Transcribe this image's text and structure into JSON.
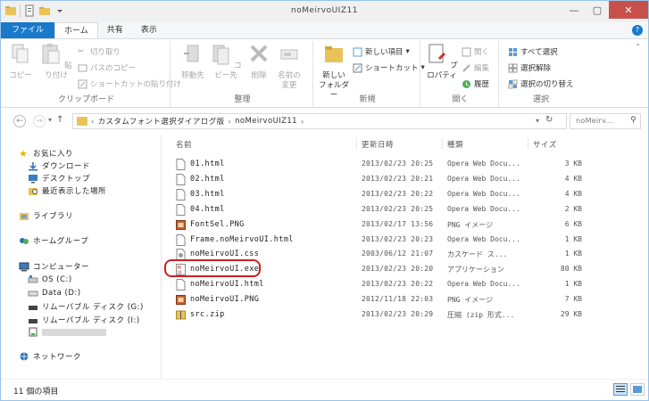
{
  "window": {
    "title": "noMeirvoUIZ11"
  },
  "ribbon_tabs": [
    {
      "label": "ファイル"
    },
    {
      "label": "ホーム"
    },
    {
      "label": "共有"
    },
    {
      "label": "表示"
    }
  ],
  "ribbon": {
    "clipboard": {
      "label": "クリップボード",
      "copy": "コピー",
      "paste": "貼り付け",
      "cut": "切り取り",
      "copy_path": "パスのコピー",
      "paste_shortcut": "ショートカットの貼り付け"
    },
    "organize": {
      "label": "整理",
      "move_to": "移動先",
      "copy_to": "コピー先",
      "delete": "削除",
      "rename_line1": "名前の",
      "rename_line2": "変更"
    },
    "new": {
      "label": "新規",
      "new_folder_line1": "新しい",
      "new_folder_line2": "フォルダー",
      "new_item": "新しい項目",
      "shortcut": "ショートカット"
    },
    "open": {
      "label": "開く",
      "properties": "プロパティ",
      "open": "開く",
      "edit": "編集",
      "history": "履歴"
    },
    "select": {
      "label": "選択",
      "select_all": "すべて選択",
      "select_none": "選択解除",
      "invert": "選択の切り替え"
    }
  },
  "address": {
    "path": [
      "カスタムフォント選択ダイアログ版",
      "noMeirvoUIZ11"
    ],
    "search_placeholder": "noMeirv...",
    "search_icon": "search-icon"
  },
  "nav_pane": {
    "favorites": "お気に入り",
    "downloads": "ダウンロード",
    "desktop": "デスクトップ",
    "recent": "最近表示した場所",
    "libraries": "ライブラリ",
    "homegroup": "ホームグループ",
    "computer": "コンピューター",
    "drive_os": "OS (C:)",
    "drive_data": "Data (D:)",
    "removable_g": "リムーバブル ディスク (G:)",
    "removable_i": "リムーバブル ディスク (I:)",
    "network": "ネットワーク"
  },
  "columns": {
    "name": "名前",
    "date": "更新日時",
    "type": "種類",
    "size": "サイズ"
  },
  "files": [
    {
      "name": "01.html",
      "date": "2013/02/23 20:25",
      "type": "Opera Web Docu...",
      "size": "3 KB",
      "icon": "html-file-icon"
    },
    {
      "name": "02.html",
      "date": "2013/02/23 20:21",
      "type": "Opera Web Docu...",
      "size": "4 KB",
      "icon": "html-file-icon"
    },
    {
      "name": "03.html",
      "date": "2013/02/23 20:22",
      "type": "Opera Web Docu...",
      "size": "4 KB",
      "icon": "html-file-icon"
    },
    {
      "name": "04.html",
      "date": "2013/02/23 20:25",
      "type": "Opera Web Docu...",
      "size": "2 KB",
      "icon": "html-file-icon"
    },
    {
      "name": "FontSel.PNG",
      "date": "2013/02/17 13:56",
      "type": "PNG イメージ",
      "size": "6 KB",
      "icon": "png-file-icon"
    },
    {
      "name": "Frame.noMeirvoUI.html",
      "date": "2013/02/23 20:23",
      "type": "Opera Web Docu...",
      "size": "1 KB",
      "icon": "html-file-icon"
    },
    {
      "name": "noMeirvoUI.css",
      "date": "2003/06/12 21:07",
      "type": "カスケード ス...",
      "size": "1 KB",
      "icon": "css-file-icon"
    },
    {
      "name": "noMeirvoUI.exe",
      "date": "2013/02/23 20:20",
      "type": "アプリケーション",
      "size": "80 KB",
      "icon": "exe-file-icon"
    },
    {
      "name": "noMeirvoUI.html",
      "date": "2013/02/23 20:22",
      "type": "Opera Web Docu...",
      "size": "1 KB",
      "icon": "html-file-icon"
    },
    {
      "name": "noMeirvoUI.PNG",
      "date": "2012/11/18 22:03",
      "type": "PNG イメージ",
      "size": "7 KB",
      "icon": "png-file-icon"
    },
    {
      "name": "src.zip",
      "date": "2013/02/23 20:29",
      "type": "圧縮 (zip 形式...",
      "size": "29 KB",
      "icon": "zip-file-icon"
    }
  ],
  "status": {
    "count": "11 個の項目"
  },
  "colors": {
    "file_tab": "#1979ca",
    "highlight_ring": "#d02020",
    "close_button": "#c7514a",
    "folder": "#e8c35a"
  }
}
